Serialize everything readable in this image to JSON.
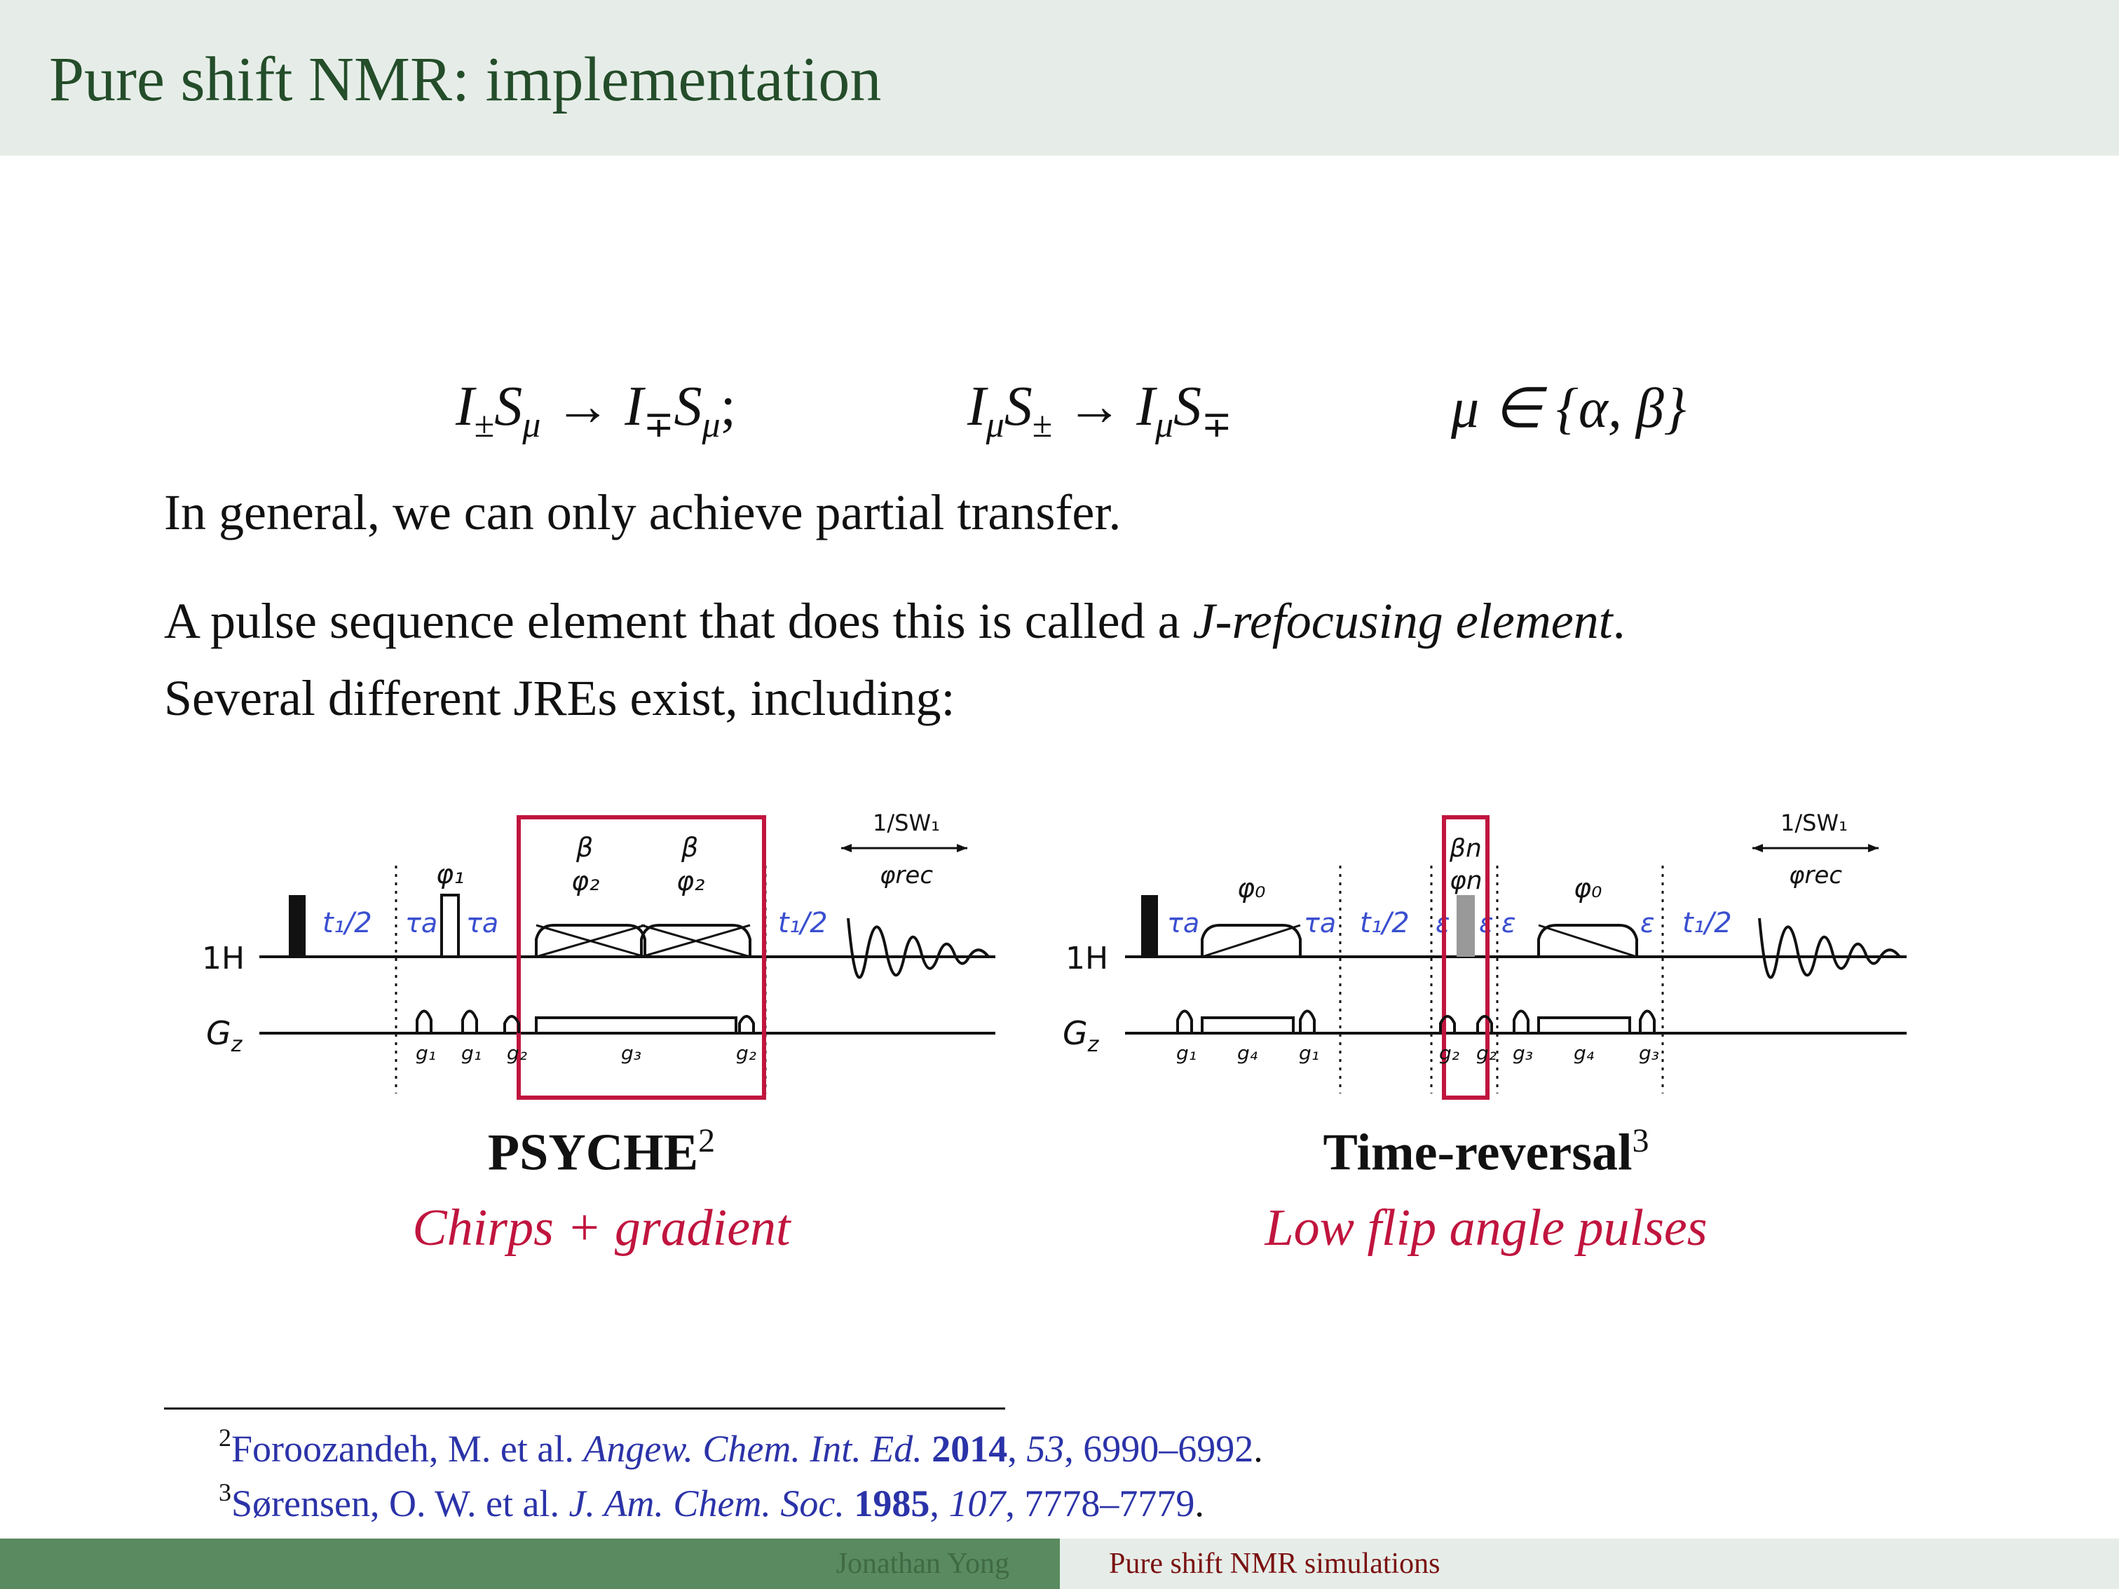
{
  "header": {
    "title": "Pure shift NMR: implementation"
  },
  "equations": {
    "eq1": {
      "a": "I",
      "a_sub": "±",
      "b": "S",
      "b_sub": "μ",
      "arrow": "→",
      "c": "I",
      "c_sub": "∓",
      "d": "S",
      "d_sub": "μ",
      "end": ";"
    },
    "eq2": {
      "a": "I",
      "a_sub": "μ",
      "b": "S",
      "b_sub": "±",
      "arrow": "→",
      "c": "I",
      "c_sub": "μ",
      "d": "S",
      "d_sub": "∓"
    },
    "eq3": {
      "text": "μ ∈ {α, β}"
    }
  },
  "body": {
    "p1": "In general, we can only achieve partial transfer.",
    "p2_pre": "A pulse sequence element that does this is called a ",
    "p2_em": "J-refocusing element",
    "p2_post": ".",
    "p3": "Several different JREs exist, including:"
  },
  "diagram_labels": {
    "h1": "1H",
    "gz": "G",
    "gz_sub": "z",
    "t1half": "t₁/2",
    "tau_a": "τa",
    "eps": "ε",
    "phi1": "φ₁",
    "phi0": "φ₀",
    "beta": "β",
    "phi2": "φ₂",
    "beta_n": "βn",
    "phi_n": "φn",
    "sw": "1/SW₁",
    "phirec": "φrec",
    "g1": "g₁",
    "g2": "g₂",
    "g3": "g₃",
    "g4": "g₄"
  },
  "captions": {
    "left_title": "PSYCHE",
    "left_ref": "2",
    "left_sub": "Chirps + gradient",
    "right_title": "Time-reversal",
    "right_ref": "3",
    "right_sub": "Low flip angle pulses"
  },
  "footnotes": [
    {
      "mark": "2",
      "authors": "Foroozandeh, M. et al. ",
      "journal": "Angew. Chem. Int. Ed.",
      "year": "2014",
      "sep1": ", ",
      "volume": "53",
      "pages": ", 6990–6992",
      "end": "."
    },
    {
      "mark": "3",
      "authors": "Sørensen, O. W. et al. ",
      "journal": "J. Am. Chem. Soc.",
      "year": "1985",
      "sep1": ", ",
      "volume": "107",
      "pages": ", 7778–7779",
      "end": "."
    }
  ],
  "footer": {
    "author": "Jonathan Yong",
    "talk": "Pure shift NMR simulations"
  },
  "colors": {
    "accent_red": "#c0153e",
    "label_blue": "#3a4fd0",
    "header_green": "#244d2a"
  }
}
